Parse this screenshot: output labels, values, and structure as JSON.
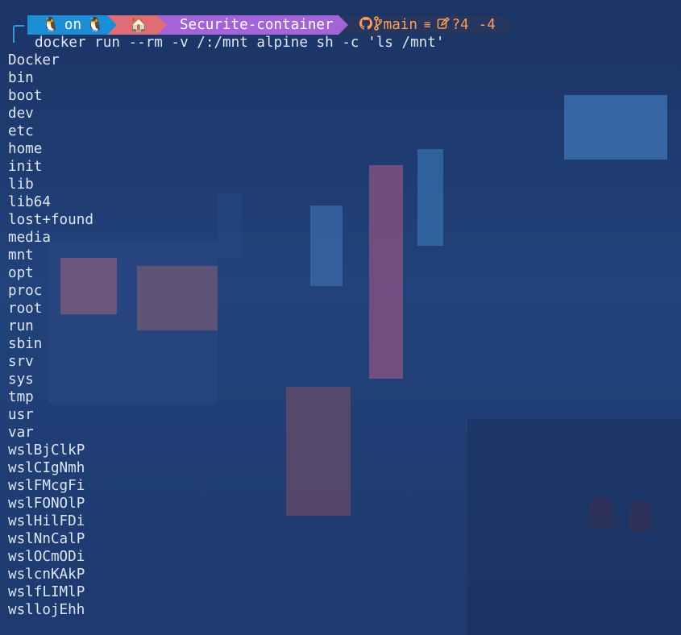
{
  "prompt": {
    "os_label": "on",
    "path": "Securite-container",
    "git_branch": "main",
    "git_stash_symbol": "≡",
    "git_untracked": "?4",
    "git_deleted": "-4"
  },
  "command": "docker run --rm -v /:/mnt alpine sh -c 'ls /mnt'",
  "output": [
    "Docker",
    "bin",
    "boot",
    "dev",
    "etc",
    "home",
    "init",
    "lib",
    "lib64",
    "lost+found",
    "media",
    "mnt",
    "opt",
    "proc",
    "root",
    "run",
    "sbin",
    "srv",
    "sys",
    "tmp",
    "usr",
    "var",
    "wslBjClkP",
    "wslCIgNmh",
    "wslFMcgFi",
    "wslFONOlP",
    "wslHilFDi",
    "wslNnCalP",
    "wslOCmODi",
    "wslcnKAkP",
    "wslfLIMlP",
    "wsllojEhh"
  ],
  "colors": {
    "os_segment": "#1d8dd6",
    "home_segment": "#e06c75",
    "path_segment": "#a463d6",
    "git_segment_text": "#ff9f55",
    "text": "#dfe6f3",
    "background": "#1f3c72"
  }
}
